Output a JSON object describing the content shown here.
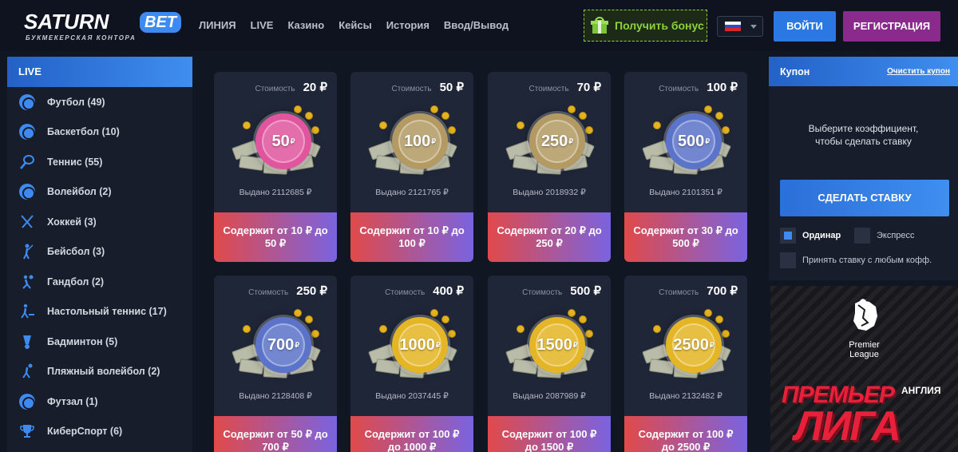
{
  "brand": {
    "name": "SATURN",
    "badge": "BET",
    "tagline": "БУКМЕКЕРСКАЯ КОНТОРА"
  },
  "nav": [
    "ЛИНИЯ",
    "LIVE",
    "Казино",
    "Кейсы",
    "История",
    "Ввод/Вывод"
  ],
  "header": {
    "bonus_label": "Получить бонус",
    "login_label": "ВОЙТИ",
    "register_label": "РЕГИСТРАЦИЯ",
    "language": "ru"
  },
  "sidebar": {
    "title": "LIVE",
    "items": [
      {
        "label": "Футбол (49)",
        "icon": "soccer-ball-icon"
      },
      {
        "label": "Баскетбол (10)",
        "icon": "basketball-icon"
      },
      {
        "label": "Теннис (55)",
        "icon": "tennis-racket-icon"
      },
      {
        "label": "Волейбол (2)",
        "icon": "volleyball-icon"
      },
      {
        "label": "Хоккей (3)",
        "icon": "hockey-sticks-icon"
      },
      {
        "label": "Бейсбол (3)",
        "icon": "baseball-player-icon"
      },
      {
        "label": "Гандбол (2)",
        "icon": "handball-icon"
      },
      {
        "label": "Настольный теннис (17)",
        "icon": "table-tennis-icon"
      },
      {
        "label": "Бадминтон (5)",
        "icon": "shuttlecock-icon"
      },
      {
        "label": "Пляжный волейбол (2)",
        "icon": "beach-volleyball-icon"
      },
      {
        "label": "Футзал (1)",
        "icon": "futsal-ball-icon"
      },
      {
        "label": "КиберСпорт (6)",
        "icon": "trophy-icon"
      }
    ]
  },
  "cases": [
    {
      "cost_label": "Стоимость",
      "cost": "20 ₽",
      "coin": "50",
      "issued": "Выдано 2112685 ₽",
      "contains": "Содержит от 10 ₽ до 50 ₽",
      "color": "#e0559e"
    },
    {
      "cost_label": "Стоимость",
      "cost": "50 ₽",
      "coin": "100",
      "issued": "Выдано 2121765 ₽",
      "contains": "Содержит от 10 ₽ до 100 ₽",
      "color": "#b39a63"
    },
    {
      "cost_label": "Стоимость",
      "cost": "70 ₽",
      "coin": "250",
      "issued": "Выдано 2018932 ₽",
      "contains": "Содержит от 20 ₽ до 250 ₽",
      "color": "#b39a63"
    },
    {
      "cost_label": "Стоимость",
      "cost": "100 ₽",
      "coin": "500",
      "issued": "Выдано 2101351 ₽",
      "contains": "Содержит от 30 ₽ до 500 ₽",
      "color": "#5b74c9"
    },
    {
      "cost_label": "Стоимость",
      "cost": "250 ₽",
      "coin": "700",
      "issued": "Выдано 2128408 ₽",
      "contains": "Содержит от 50 ₽ до 700 ₽",
      "color": "#5b74c9"
    },
    {
      "cost_label": "Стоимость",
      "cost": "400 ₽",
      "coin": "1000",
      "issued": "Выдано 2037445 ₽",
      "contains": "Содержит от 100 ₽ до 1000 ₽",
      "color": "#e4b524"
    },
    {
      "cost_label": "Стоимость",
      "cost": "500 ₽",
      "coin": "1500",
      "issued": "Выдано 2087989 ₽",
      "contains": "Содержит от 100 ₽ до 1500 ₽",
      "color": "#e4b524"
    },
    {
      "cost_label": "Стоимость",
      "cost": "700 ₽",
      "coin": "2500",
      "issued": "Выдано 2132482 ₽",
      "contains": "Содержит от 100 ₽ до 2500 ₽",
      "color": "#e4b524"
    }
  ],
  "coupon": {
    "title": "Купон",
    "clear_label": "Очистить купон",
    "message_line1": "Выберите коэффициент,",
    "message_line2": "чтобы сделать ставку",
    "bet_button": "СДЕЛАТЬ СТАВКУ",
    "option_single": "Ординар",
    "option_express": "Экспресс",
    "option_any_odds": "Принять ставку с любым кофф."
  },
  "banner": {
    "logo_text_1": "Premier",
    "logo_text_2": "League",
    "headline_1": "ПРЕМЬЕР",
    "headline_small": "АНГЛИЯ",
    "headline_2": "ЛИГА"
  },
  "colors": {
    "accent": "#3d8bf0",
    "register": "#8a2a8c",
    "bonus": "#8bd23b",
    "background": "#111623"
  }
}
